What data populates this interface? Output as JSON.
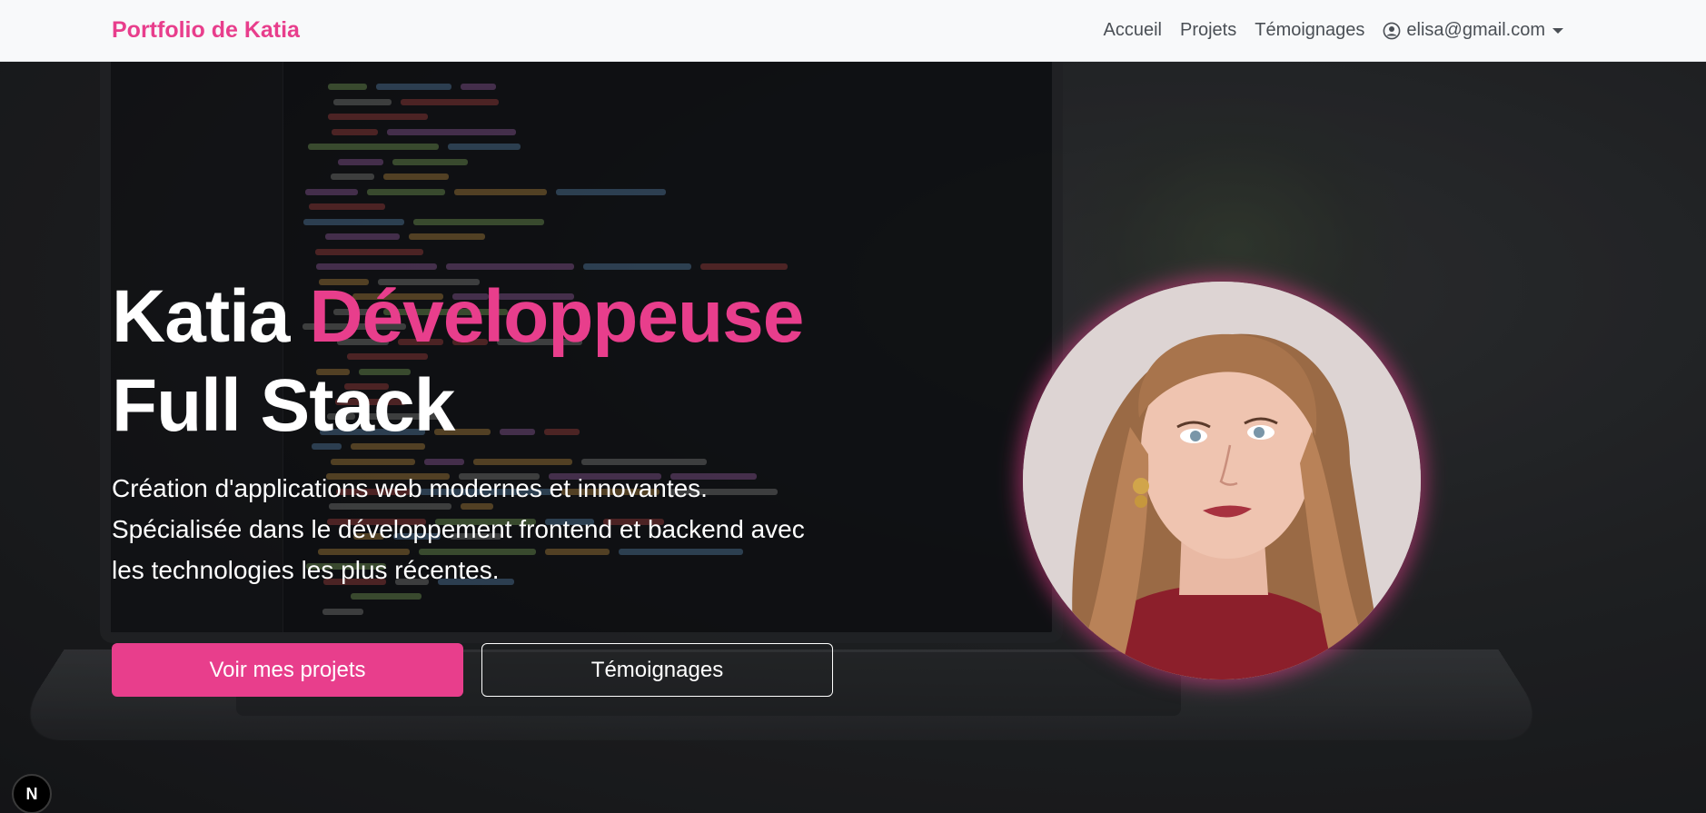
{
  "navbar": {
    "brand": "Portfolio de Katia",
    "links": [
      "Accueil",
      "Projets",
      "Témoignages"
    ],
    "user_email": "elisa@gmail.com",
    "user_icon": "person-circle-icon"
  },
  "hero": {
    "title_name": "Katia",
    "title_accent": "Développeuse",
    "title_line2": "Full Stack",
    "description_line1": "Création d'applications web modernes et innovantes.",
    "description_line2": "Spécialisée dans le développement frontend et backend avec",
    "description_line3": "les technologies les plus récentes.",
    "primary_button": "Voir mes projets",
    "secondary_button": "Témoignages"
  },
  "badge": {
    "label": "N",
    "icon": "nextjs-logo-icon"
  },
  "colors": {
    "accent": "#e83e8c",
    "navbar_bg": "#f8f9fa",
    "text_dark": "#4a4f55"
  }
}
